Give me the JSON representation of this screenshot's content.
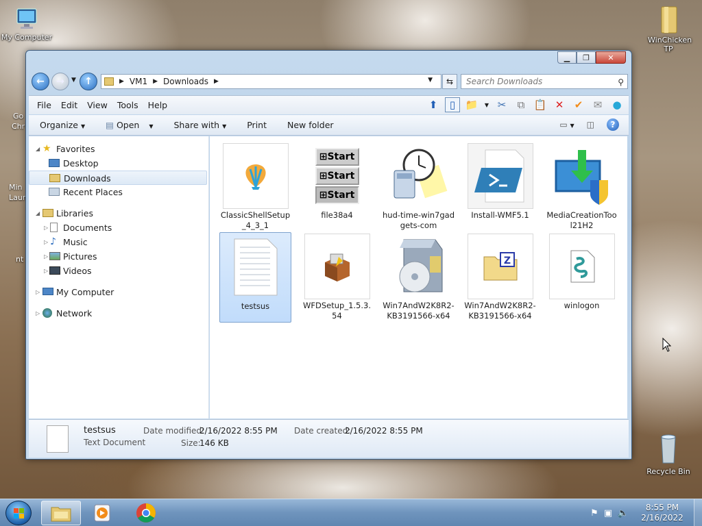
{
  "desktop": {
    "icons": [
      {
        "label": "My Computer"
      },
      {
        "label": "WinChicken TP"
      },
      {
        "label": "Recycle Bin"
      }
    ],
    "fragments": [
      "Go",
      "Chr",
      "Min",
      "Laun",
      "nt"
    ]
  },
  "window": {
    "address": {
      "segments": [
        "VM1",
        "Downloads"
      ]
    },
    "search_placeholder": "Search Downloads",
    "menu": [
      "File",
      "Edit",
      "View",
      "Tools",
      "Help"
    ],
    "commands": [
      "Organize",
      "Open",
      "Share with",
      "Print",
      "New folder"
    ],
    "nav": {
      "favorites": {
        "label": "Favorites",
        "items": [
          "Desktop",
          "Downloads",
          "Recent Places"
        ]
      },
      "libraries": {
        "label": "Libraries",
        "items": [
          "Documents",
          "Music",
          "Pictures",
          "Videos"
        ]
      },
      "computer": "My Computer",
      "network": "Network"
    },
    "files": [
      {
        "name": "ClassicShellSetup_4_3_1",
        "icon": "shell-icon"
      },
      {
        "name": "file38a4",
        "icon": "start-buttons-icon"
      },
      {
        "name": "hud-time-win7gadgets-com",
        "icon": "gadget-clock-icon"
      },
      {
        "name": "Install-WMF5.1",
        "icon": "powershell-icon"
      },
      {
        "name": "MediaCreationTool21H2",
        "icon": "media-creation-icon"
      },
      {
        "name": "testsus",
        "icon": "text-document-icon"
      },
      {
        "name": "WFDSetup_1.5.3.54",
        "icon": "installer-box-icon"
      },
      {
        "name": "Win7AndW2K8R2-KB3191566-x64",
        "icon": "setup-disc-icon"
      },
      {
        "name": "Win7AndW2K8R2-KB3191566-x64",
        "icon": "zip-folder-icon"
      },
      {
        "name": "winlogon",
        "icon": "script-icon"
      }
    ],
    "details": {
      "name": "testsus",
      "type": "Text Document",
      "date_modified_label": "Date modified:",
      "date_modified": "2/16/2022 8:55 PM",
      "date_created_label": "Date created:",
      "date_created": "2/16/2022 8:55 PM",
      "size_label": "Size:",
      "size": "146 KB"
    }
  },
  "taskbar": {
    "time": "8:55 PM",
    "date": "2/16/2022"
  },
  "colors": {
    "selection": "#c1dcfb",
    "accent": "#2b6fc2"
  }
}
